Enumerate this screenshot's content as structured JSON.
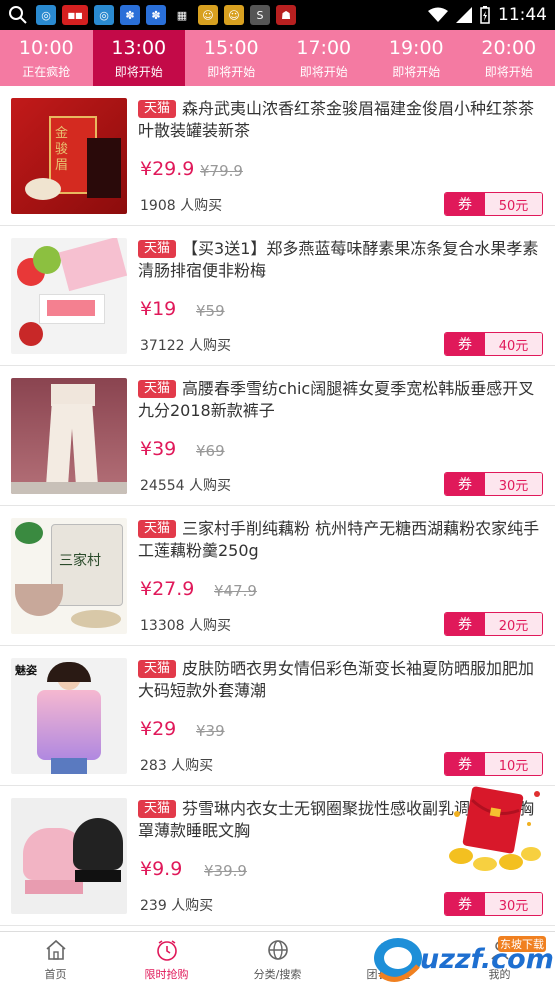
{
  "status_bar": {
    "time": "11:44"
  },
  "time_tabs": [
    {
      "time": "10:00",
      "status": "正在疯抢"
    },
    {
      "time": "13:00",
      "status": "即将开始"
    },
    {
      "time": "15:00",
      "status": "即将开始"
    },
    {
      "time": "17:00",
      "status": "即将开始"
    },
    {
      "time": "19:00",
      "status": "即将开始"
    },
    {
      "time": "20:00",
      "status": "即将开始"
    }
  ],
  "products": [
    {
      "tag": "天猫",
      "title": "森舟武夷山浓香红茶金骏眉福建金俊眉小种红茶茶叶散装罐装新茶",
      "price": "¥29.9",
      "old_price": "¥79.9",
      "buyers": "1908 人购买",
      "coupon_label": "券",
      "coupon_value": "50元"
    },
    {
      "tag": "天猫",
      "title": "【买3送1】郑多燕蓝莓味酵素果冻条复合水果孝素清肠排宿便非粉梅",
      "price": "¥19",
      "old_price": "¥59",
      "buyers": "37122 人购买",
      "coupon_label": "券",
      "coupon_value": "40元"
    },
    {
      "tag": "天猫",
      "title": "高腰春季雪纺chic阔腿裤女夏季宽松韩版垂感开叉九分2018新款裤子",
      "price": "¥39",
      "old_price": "¥69",
      "buyers": "24554 人购买",
      "coupon_label": "券",
      "coupon_value": "30元"
    },
    {
      "tag": "天猫",
      "title": "三家村手削纯藕粉 杭州特产无糖西湖藕粉农家纯手工莲藕粉羹250g",
      "price": "¥27.9",
      "old_price": "¥47.9",
      "buyers": "13308 人购买",
      "coupon_label": "券",
      "coupon_value": "20元"
    },
    {
      "tag": "天猫",
      "title": "皮肤防晒衣男女情侣彩色渐变长袖夏防晒服加肥加大码短款外套薄潮",
      "price": "¥29",
      "old_price": "¥39",
      "buyers": "283 人购买",
      "coupon_label": "券",
      "coupon_value": "10元"
    },
    {
      "tag": "天猫",
      "title": "芬雪琳内衣女士无钢圈聚拢性感收副乳调整心式胸罩薄款睡眠文胸",
      "price": "¥9.9",
      "old_price": "¥39.9",
      "buyers": "239 人购买",
      "coupon_label": "券",
      "coupon_value": "30元"
    }
  ],
  "thumb_text": {
    "p0_brand": "金骏眉",
    "p3_brand": "三家村",
    "p4_brand": "魅姿"
  },
  "bottom_nav": [
    {
      "label": "首页",
      "icon": "home-icon"
    },
    {
      "label": "限时抢购",
      "icon": "clock-icon"
    },
    {
      "label": "分类/搜索",
      "icon": "globe-icon"
    },
    {
      "label": "团长权益",
      "icon": "badge-icon"
    },
    {
      "label": "我的",
      "icon": "user-icon"
    }
  ],
  "watermark": {
    "text": "uzzf.com",
    "sub": "东坡下载"
  },
  "colors": {
    "accent": "#e0195a",
    "tab_bg": "#f47aa2",
    "tab_active": "#c30a48"
  }
}
